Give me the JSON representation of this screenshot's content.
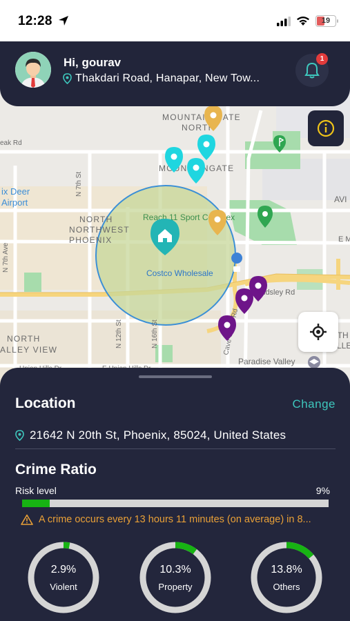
{
  "status_bar": {
    "time": "12:28",
    "battery": "19"
  },
  "header": {
    "greeting": "Hi, gourav",
    "address": "Thakdari Road, Hanapar, New Tow...",
    "notification_count": "1"
  },
  "map": {
    "labels": {
      "mountain_gate_north": "MOUNTAIN GATE NORTH",
      "mountain_gate_north_l1": "MOUNTAIN GATE",
      "mountain_gate_north_l2": "NORTH",
      "mountain_gate": "MOUNTAINGATE",
      "oak_rd": "eak Rd",
      "deer_airport_l1": "ix Deer",
      "deer_airport_l2": "Airport",
      "n_7th_st": "N 7th St",
      "north_nw_phoenix_l1": "NORTH",
      "north_nw_phoenix_l2": "NORTHWEST",
      "north_nw_phoenix_l3": "PHOENIX",
      "reach_11": "Reach 11 Sport Complex",
      "costco": "Costco Wholesale",
      "n_7th_ave": "N 7th Ave",
      "n_12th_st": "N 12th St",
      "n_16th_st": "N 16th St",
      "ldsley_rd": "ldsley Rd",
      "ave": "AVI",
      "e_m": "E M",
      "north_valley_l1": "NORTH",
      "north_valley_l2": "ALLEY VIEW",
      "cave_creek": "Cave Creek Rd",
      "paradise_valley": "Paradise Valley",
      "e_union_hills": "E Union Hills Dr",
      "union_hills_left": "Union Hills Dr",
      "nth_l1": "NTH",
      "nth_l2": "ALLE"
    },
    "colors": {
      "map_bg": "#eceae6",
      "road_major": "#f6d57e",
      "park": "#a7dcac",
      "radius_fill": "#c7d79a",
      "radius_stroke": "#3b8fd6",
      "pin_cyan": "#1fd6e0",
      "pin_orange": "#e8b54f",
      "pin_purple": "#6e1589",
      "pin_green": "#2fa651",
      "home_pin": "#23b5b5"
    }
  },
  "sheet": {
    "location_title": "Location",
    "change_label": "Change",
    "location_address": "21642 N 20th St, Phoenix, 85024, United States",
    "crime_title": "Crime Ratio",
    "risk_label": "Risk level",
    "risk_percent_text": "9%",
    "risk_value": 0.09,
    "warning_text": "A crime occurs every 13 hours 11 minutes (on average) in 8...",
    "stats": [
      {
        "percent_text": "2.9%",
        "label": "Violent",
        "value": 0.029
      },
      {
        "percent_text": "10.3%",
        "label": "Property",
        "value": 0.103
      },
      {
        "percent_text": "13.8%",
        "label": "Others",
        "value": 0.138
      }
    ],
    "colors": {
      "sheet_bg": "#23263c",
      "accent": "#3ec7bd",
      "risk_fill": "#17b313",
      "track": "#d5d5d5",
      "warning": "#e9a037"
    }
  }
}
